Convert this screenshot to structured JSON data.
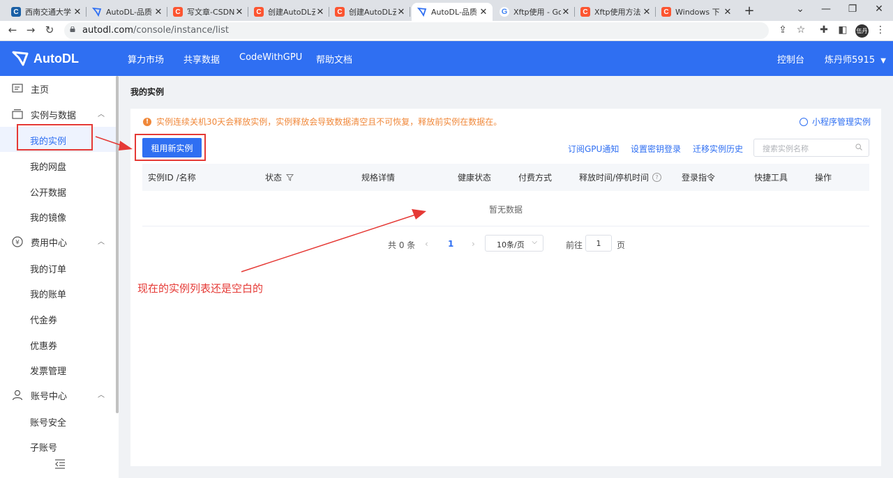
{
  "browser": {
    "tabs": [
      {
        "title": "西南交通大学",
        "favicon": "csdn-dark"
      },
      {
        "title": "AutoDL-品质",
        "favicon": "autodl"
      },
      {
        "title": "写文章-CSDN",
        "favicon": "csdn"
      },
      {
        "title": "创建AutoDL云",
        "favicon": "csdn"
      },
      {
        "title": "创建AutoDL云",
        "favicon": "csdn"
      },
      {
        "title": "AutoDL-品质",
        "favicon": "autodl",
        "active": true
      },
      {
        "title": "Xftp使用 - Go",
        "favicon": "google"
      },
      {
        "title": "Xftp使用方法",
        "favicon": "csdn"
      },
      {
        "title": "Windows 下",
        "favicon": "csdn"
      }
    ],
    "url_host": "autodl.com",
    "url_path": "/console/instance/list",
    "profile_label": "伍丹"
  },
  "header": {
    "logo": "AutoDL",
    "nav": [
      "算力市场",
      "共享数据",
      "CodeWithGPU",
      "帮助文档"
    ],
    "console": "控制台",
    "user": "炼丹师5915"
  },
  "sidebar": {
    "home": "主页",
    "groups": [
      {
        "label": "实例与数据",
        "items": [
          "我的实例",
          "我的网盘",
          "公开数据",
          "我的镜像"
        ]
      },
      {
        "label": "费用中心",
        "items": [
          "我的订单",
          "我的账单",
          "代金券",
          "优惠券",
          "发票管理"
        ]
      },
      {
        "label": "账号中心",
        "items": [
          "账号安全",
          "子账号"
        ]
      }
    ],
    "active_item": "我的实例"
  },
  "main": {
    "page_title": "我的实例",
    "notice": "实例连续关机30天会释放实例，实例释放会导致数据清空且不可恢复，释放前实例在数据在。",
    "mini_program_link": "小程序管理实例",
    "rent_button": "租用新实例",
    "toolbar_links": [
      "订阅GPU通知",
      "设置密钥登录",
      "迁移实例历史"
    ],
    "search_placeholder": "搜索实例名称",
    "table_headers": [
      "实例ID /名称",
      "状态",
      "规格详情",
      "健康状态",
      "付费方式",
      "释放时间/停机时间",
      "登录指令",
      "快捷工具",
      "操作"
    ],
    "empty_text": "暂无数据",
    "pagination": {
      "total": "共 0 条",
      "current_page": "1",
      "page_size": "10条/页",
      "goto_prefix": "前往",
      "goto_value": "1",
      "goto_suffix": "页"
    }
  },
  "annotation": {
    "text": "现在的实例列表还是空白的",
    "color": "#e53935"
  },
  "colors": {
    "brand": "#2f6ff2",
    "warning": "#f0883a"
  }
}
